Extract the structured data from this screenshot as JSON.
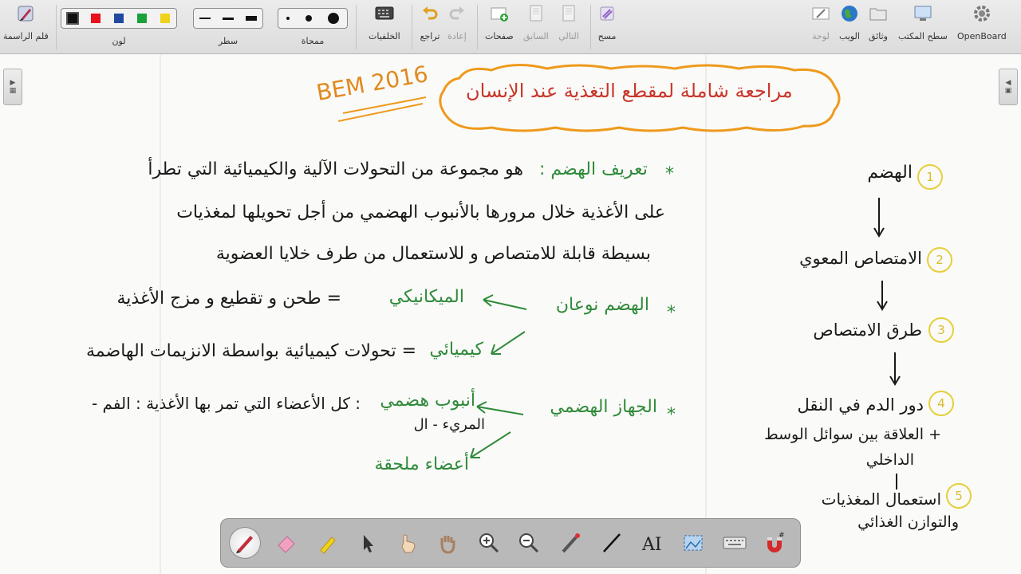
{
  "toolbar": {
    "pen_label": "قلم الراسمة",
    "color_label": "لون",
    "line_label": "سطر",
    "eraser_label": "ممحاة",
    "backgrounds_label": "الخلفيات",
    "undo_label": "تراجع",
    "redo_label": "إعادة",
    "pages_label": "صفحات",
    "previous_label": "السابق",
    "next_label": "التالي",
    "clear_label": "مسح",
    "board_label": "لوحة",
    "web_label": "الويب",
    "documents_label": "وثائق",
    "desktop_label": "سطح المكتب",
    "app_label": "OpenBoard",
    "colors": [
      "#111111",
      "#e8101a",
      "#1f4aa0",
      "#1aa23a",
      "#f0d21a"
    ]
  },
  "board": {
    "title": "مراجعة شاملة لمقطع التغذية عند الإنسان",
    "tag": "BEM 2016",
    "definition_heading": "تعريف الهضم :",
    "definition_line1": "هو مجموعة من التحولات الآلية والكيميائية التي تطرأ",
    "definition_line2": "على الأغذية خلال مرورها بالأنبوب الهضمي من أجل تحويلها لمغذيات",
    "definition_line3": "بسيطة قابلة للامتصاص و للاستعمال من طرف خلايا العضوية",
    "types_heading": "الهضم نوعان",
    "mechanical": "الميكانيكي",
    "mechanical_desc": "= طحن و تقطيع و مزج الأغذية",
    "chemical": "كيميائي",
    "chemical_desc": "= تحولات كيميائية بواسطة الانزيمات الهاضمة",
    "system_heading": "الجهاز الهضمي",
    "tube": "أنبوب هضمي",
    "tube_desc": ": كل الأعضاء التي تمر بها الأغذية : الفم -",
    "tube_sub": "المريء - ال",
    "annexes": "أعضاء ملحقة",
    "star": "*",
    "flow": {
      "n1": "1",
      "s1": "الهضم",
      "n2": "2",
      "s2": "الامتصاص المعوي",
      "n3": "3",
      "s3": "طرق الامتصاص",
      "n4": "4",
      "s4": "دور الدم في النقل",
      "s4b": "+ العلاقة بين سوائل الوسط",
      "s4c": "الداخلي",
      "n5": "5",
      "s5": "استعمال المغذيات",
      "s5b": "والتوازن الغذائي"
    }
  }
}
